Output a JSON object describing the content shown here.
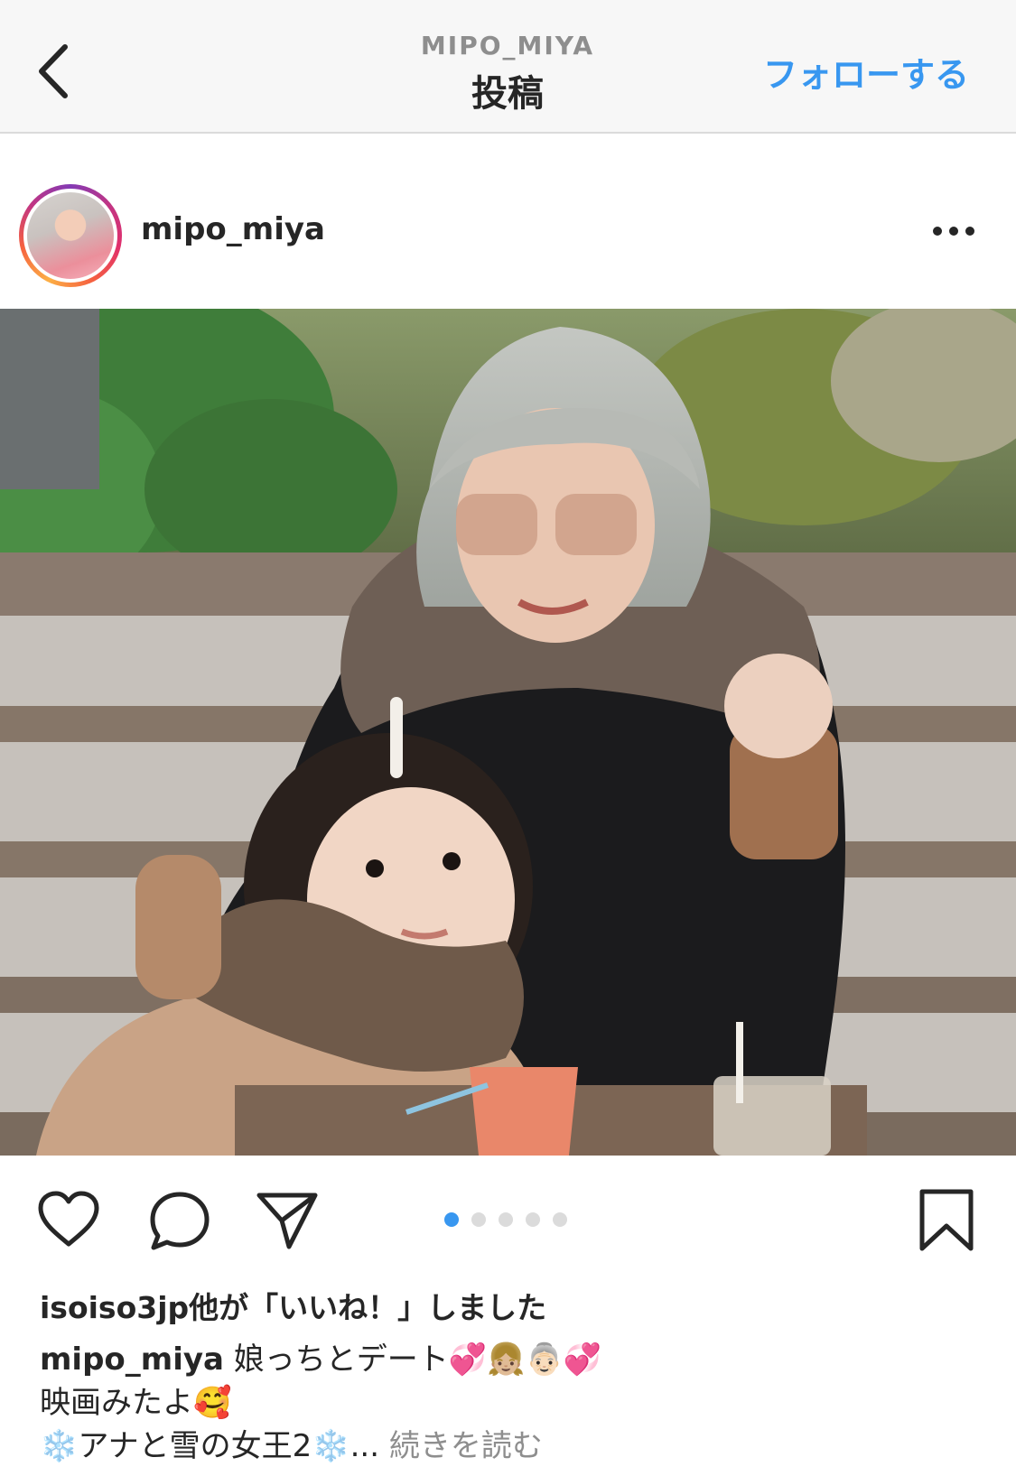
{
  "nav": {
    "username": "MIPO_MIYA",
    "title": "投稿",
    "follow_label": "フォローする",
    "back_icon": "chevron-left-icon"
  },
  "post": {
    "username": "mipo_miya",
    "more_icon": "more-dots-icon",
    "carousel": {
      "count": 5,
      "active_index": 0
    }
  },
  "actions": {
    "like_icon": "heart-icon",
    "comment_icon": "comment-icon",
    "share_icon": "send-icon",
    "save_icon": "bookmark-icon"
  },
  "likes_text": "isoiso3jp他が「いいね！」しました",
  "caption": {
    "username": "mipo_miya",
    "line1": "娘っちとデート💞👧🏼👵🏻💞",
    "line2": "映画みたよ🥰",
    "line3": "❄️アナと雪の女王2❄️...",
    "more_label": "続きを読む"
  },
  "colors": {
    "accent": "#3897f0",
    "text": "#262626",
    "muted": "#8e8e8e",
    "nav_bg": "#f7f7f7"
  }
}
